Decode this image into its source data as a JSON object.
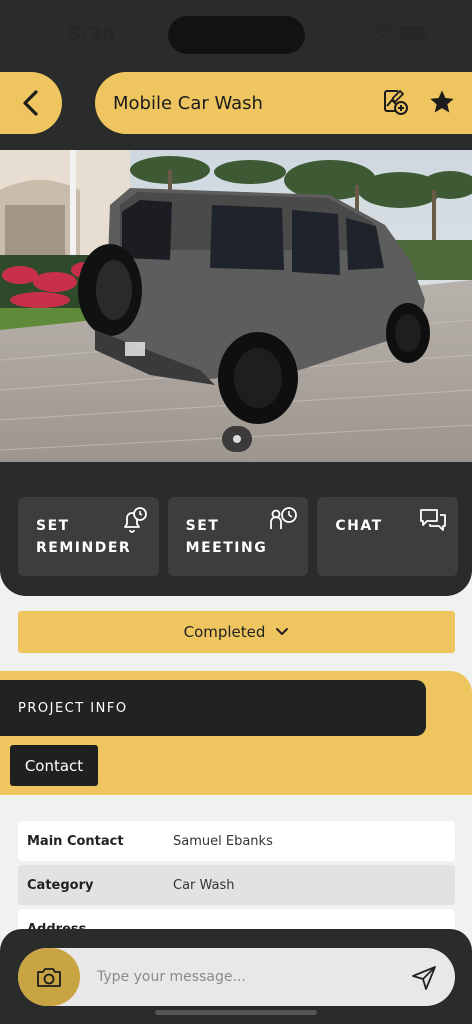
{
  "status_bar": {
    "time": "5:38"
  },
  "header": {
    "title": "Mobile Car Wash",
    "icons": [
      "back-arrow-icon",
      "add-photo-icon",
      "star-icon"
    ]
  },
  "photo": {
    "subject": "car-photo",
    "page_count": 1,
    "current_page": 1
  },
  "actions": [
    {
      "label": "SET\nREMINDER",
      "icon": "alarm-bell-icon"
    },
    {
      "label": "SET\nMEETING",
      "icon": "meeting-icon"
    },
    {
      "label": "CHAT",
      "icon": "chat-icon"
    }
  ],
  "status": {
    "value": "Completed"
  },
  "project_info": {
    "heading": "PROJECT INFO",
    "tab": "Contact",
    "rows": [
      {
        "key": "Main Contact",
        "value": "Samuel Ebanks"
      },
      {
        "key": "Category",
        "value": "Car Wash"
      },
      {
        "key": "Address",
        "value": ""
      }
    ]
  },
  "composer": {
    "placeholder": "Type your message..."
  },
  "colors": {
    "accent": "#eec55f",
    "dark": "#2a2c2b",
    "card": "#3c3d3c"
  }
}
